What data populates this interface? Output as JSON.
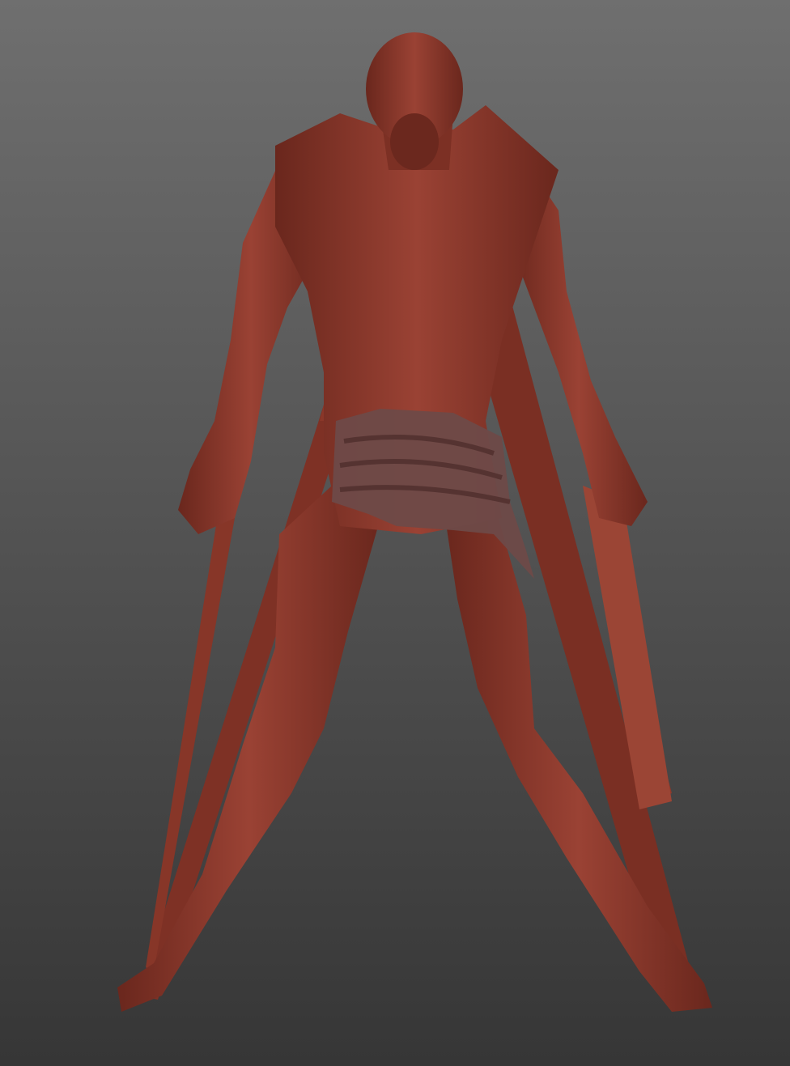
{
  "viewport": {
    "background_top": "#6f6f6f",
    "background_bottom": "#363636"
  },
  "model": {
    "type": "sculpted-human-figure",
    "material_color": "#8e3a2c",
    "shadow_color": "#5a2119",
    "highlight_color": "#a4483a",
    "cloth_color": "#6e4a48"
  }
}
